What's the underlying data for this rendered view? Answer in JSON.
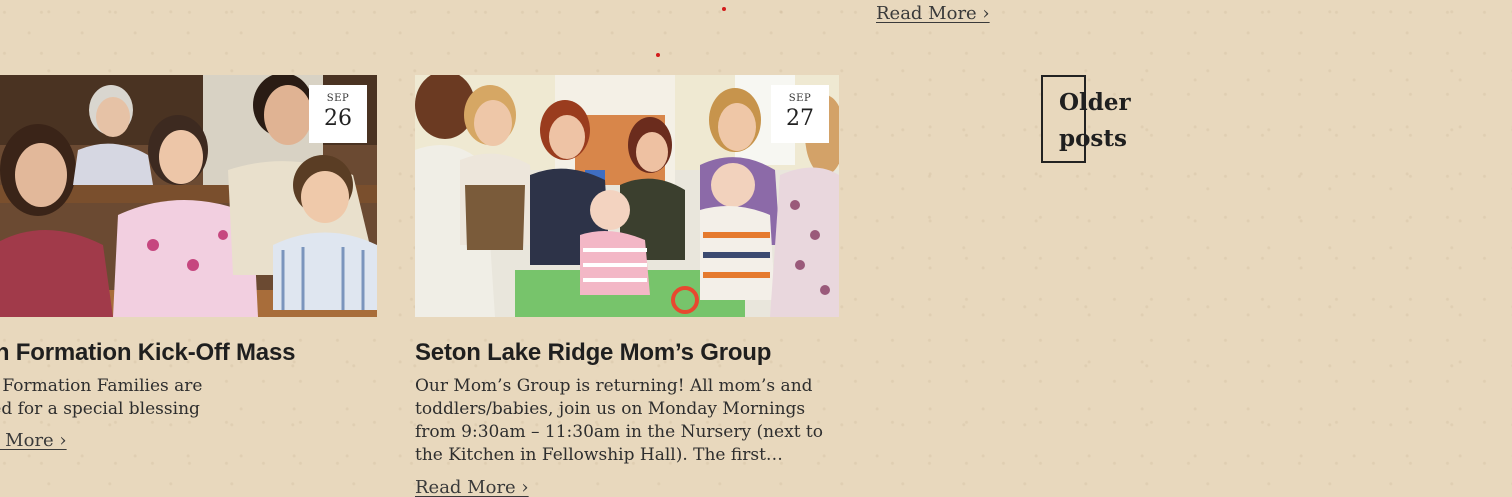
{
  "top_read_more": "Read More ›",
  "posts": [
    {
      "month": "SEP",
      "day": "26",
      "title": "Faith Formation Kick-Off Mass",
      "excerpt": "Faith Formation Families are invited for a special blessing",
      "read_more": "Read More ›",
      "image_icon": "church-family-photo"
    },
    {
      "month": "SEP",
      "day": "27",
      "title": "Seton Lake Ridge Mom’s Group",
      "excerpt": "Our Mom’s Group is returning!  All mom’s and toddlers/babies, join us on Monday Mornings from 9:30am – 11:30am in the Nursery (next to the Kitchen in Fellowship Hall). The first…",
      "read_more": "Read More ›",
      "image_icon": "moms-group-photo"
    }
  ],
  "pagination": {
    "older_posts": "Older posts"
  },
  "colors": {
    "background": "#e8d8bd",
    "text": "#2b2b2b",
    "accent_dot": "#d21b1b"
  }
}
